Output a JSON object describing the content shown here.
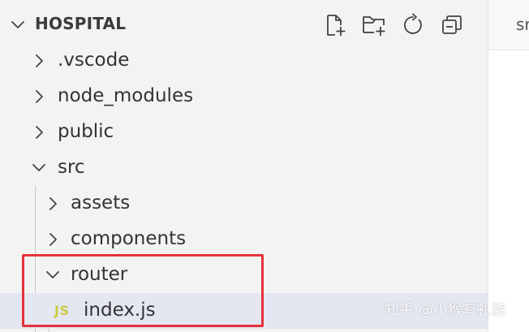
{
  "explorer": {
    "section_title": "HOSPITAL",
    "actions": [
      {
        "name": "new-file",
        "title": ""
      },
      {
        "name": "new-folder",
        "title": ""
      },
      {
        "name": "refresh",
        "title": ""
      },
      {
        "name": "collapse-all",
        "title": ""
      }
    ],
    "tree": [
      {
        "label": ".vscode",
        "type": "folder",
        "expanded": false,
        "depth": 0
      },
      {
        "label": "node_modules",
        "type": "folder",
        "expanded": false,
        "depth": 0
      },
      {
        "label": "public",
        "type": "folder",
        "expanded": false,
        "depth": 0
      },
      {
        "label": "src",
        "type": "folder",
        "expanded": true,
        "depth": 0
      },
      {
        "label": "assets",
        "type": "folder",
        "expanded": false,
        "depth": 1
      },
      {
        "label": "components",
        "type": "folder",
        "expanded": false,
        "depth": 1
      },
      {
        "label": "router",
        "type": "folder",
        "expanded": true,
        "depth": 1
      },
      {
        "label": "index.js",
        "type": "file",
        "badge": "JS",
        "selected": true,
        "depth": 2
      }
    ]
  },
  "editor": {
    "tab_label_partial": "sr"
  },
  "watermark": {
    "text": "知乎 @小猴有礼貌"
  },
  "colors": {
    "sidebar_bg": "#f3f3f3",
    "selected_bg": "#e4e6f1",
    "highlight_border": "#e5323b",
    "js_badge": "#cbcb41",
    "text": "#333333"
  }
}
